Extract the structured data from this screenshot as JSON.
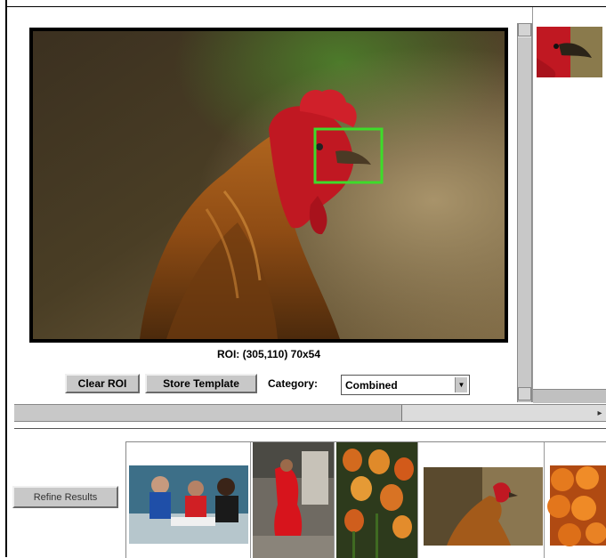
{
  "viewer": {
    "roi_text": "ROI: (305,110) 70x54",
    "roi_box_color": "#3ddc2a"
  },
  "controls": {
    "clear_roi_label": "Clear ROI",
    "store_template_label": "Store Template",
    "category_label": "Category:",
    "category_value": "Combined",
    "refine_label": "Refine Results"
  },
  "templates": {
    "items": [
      "rooster-head-template"
    ]
  },
  "results": {
    "items": [
      "people-at-table",
      "red-dancer",
      "tulips",
      "rooster",
      "oranges"
    ]
  }
}
